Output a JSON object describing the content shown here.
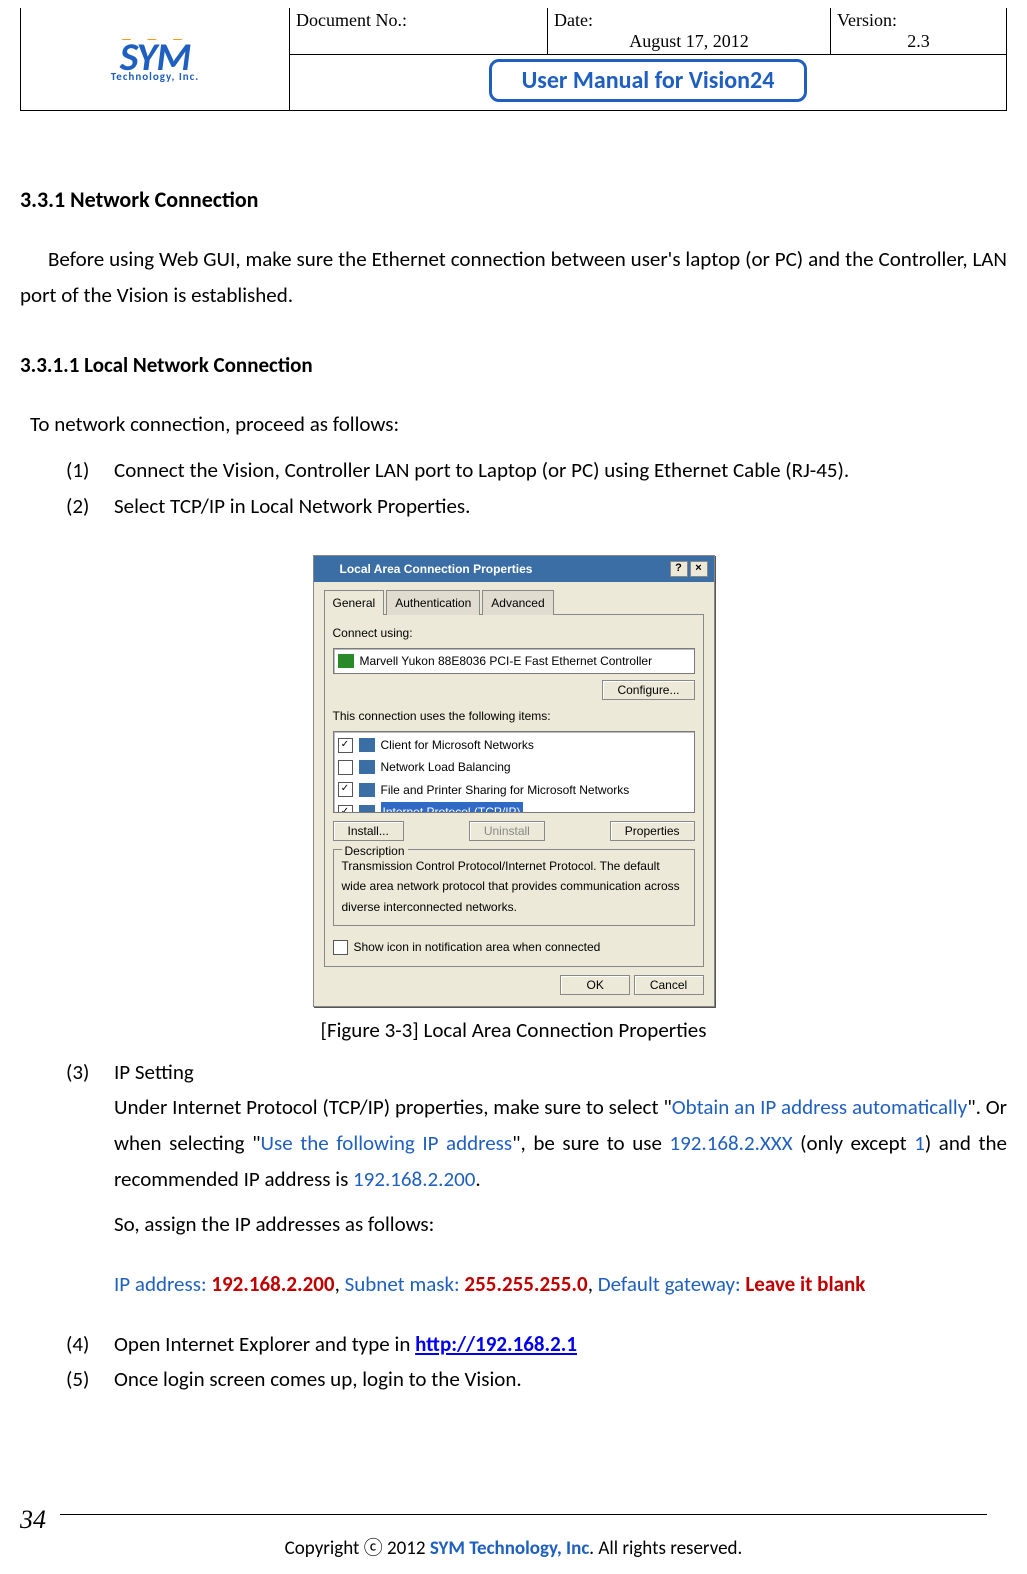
{
  "header": {
    "logo_main": "SYM",
    "logo_sub": "Technology, Inc.",
    "docno_label": "Document No.:",
    "docno_value": "",
    "date_label": "Date:",
    "date_value": "August 17, 2012",
    "version_label": "Version:",
    "version_value": "2.3",
    "title": "User Manual for Vision24"
  },
  "sec": {
    "h_331": "3.3.1    Network Connection",
    "p1": "Before using Web GUI, make sure the Ethernet connection between user's laptop (or PC) and the Controller, LAN port of the Vision is established.",
    "h_3311": "3.3.1.1    Local Network Connection",
    "p2": "To network connection, proceed as follows:",
    "steps": [
      "Connect the Vision, Controller LAN port to Laptop (or PC) using Ethernet Cable (RJ-45).",
      "Select TCP/IP in Local Network Properties."
    ],
    "fig_caption": "[Figure 3-3] Local Area Connection Properties",
    "step3_label": "IP Setting",
    "step3_a1": "Under Internet Protocol (TCP/IP) properties, make sure to select \"",
    "step3_b1": "Obtain an IP address automatically",
    "step3_a2": "\". Or when selecting \"",
    "step3_b2": "Use the following IP address",
    "step3_a3": "\", be sure to use ",
    "step3_b3": "192.168.2.XXX",
    "step3_a4": " (only except ",
    "step3_b4": "1",
    "step3_a5": ") and the recommended IP address is ",
    "step3_b5": "192.168.2.200",
    "step3_a6": ".",
    "step3_p2": "So, assign the IP addresses as follows:",
    "ip_l1": "IP address",
    "ip_v1": "192.168.2.200",
    "ip_l2": "Subnet mask",
    "ip_v2": "255.255.255.0",
    "ip_l3": "Default gateway",
    "ip_v3": "Leave it blank",
    "step4_a": "Open Internet Explorer and type in ",
    "step4_link": "http://192.168.2.1",
    "step5": "Once login screen comes up, login to the Vision."
  },
  "dialog": {
    "title": "Local Area Connection Properties",
    "tabs": [
      "General",
      "Authentication",
      "Advanced"
    ],
    "connect_using_label": "Connect using:",
    "adapter": "Marvell Yukon 88E8036 PCI-E Fast Ethernet Controller",
    "configure_btn": "Configure...",
    "items_label": "This connection uses the following items:",
    "items": [
      {
        "checked": true,
        "label": "Client for Microsoft Networks"
      },
      {
        "checked": false,
        "label": "Network Load Balancing"
      },
      {
        "checked": true,
        "label": "File and Printer Sharing for Microsoft Networks"
      },
      {
        "checked": true,
        "label": "Internet Protocol (TCP/IP)",
        "selected": true
      }
    ],
    "install_btn": "Install...",
    "uninstall_btn": "Uninstall",
    "properties_btn": "Properties",
    "desc_legend": "Description",
    "desc_text": "Transmission Control Protocol/Internet Protocol. The default wide area network protocol that provides communication across diverse interconnected networks.",
    "show_icon": "Show icon in notification area when connected",
    "ok_btn": "OK",
    "cancel_btn": "Cancel"
  },
  "footer": {
    "page": "34",
    "copy_a": "Copyright ",
    "copy_sym": "ⓒ",
    "copy_b": " 2012 ",
    "copy_company": "SYM Technology, Inc",
    "copy_c": ". All rights reserved."
  }
}
